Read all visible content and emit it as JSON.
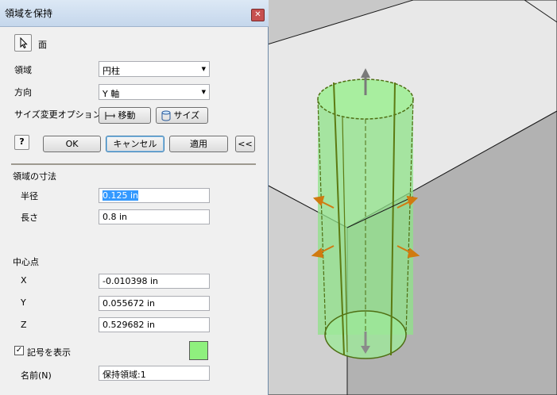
{
  "dialog": {
    "title": "領域を保持",
    "close_glyph": "✕",
    "face_label": "面",
    "region_label": "領域",
    "region_value": "円柱",
    "direction_label": "方向",
    "direction_value": "Y 軸",
    "resize_options_label": "サイズ変更オプション",
    "move_label": "移動",
    "size_label": "サイズ",
    "help_glyph": "?",
    "ok_label": "OK",
    "cancel_label": "キャンセル",
    "apply_label": "適用",
    "collapse_label": "<<",
    "dimensions_heading": "領域の寸法",
    "radius_label": "半径",
    "radius_value": "0.125 in",
    "length_label": "長さ",
    "length_value": "0.8 in",
    "center_heading": "中心点",
    "x_label": "X",
    "x_value": "-0.010398 in",
    "y_label": "Y",
    "y_value": "0.055672 in",
    "z_label": "Z",
    "z_value": "0.529682 in",
    "show_symbol_label": "記号を表示",
    "show_symbol_checked": true,
    "symbol_color": "#8ff07e",
    "name_label": "名前(N)",
    "name_value": "保持領域:1"
  },
  "icons": {
    "select": "cursor-arrow-icon",
    "move": "move-icon",
    "size": "cylinder-icon",
    "help": "help-icon",
    "close": "close-icon",
    "arrow_up": "arrow-up-icon",
    "arrow_down": "arrow-down-icon",
    "resize_handles": "resize-handle-icon"
  },
  "colors": {
    "cylinder_fill": "#9ee89a",
    "cylinder_edge": "#5c8a1e",
    "handle": "#d07a10",
    "box_top": "#e6e6e6",
    "box_front": "#b9b9b9",
    "box_right": "#a8a8a8"
  }
}
